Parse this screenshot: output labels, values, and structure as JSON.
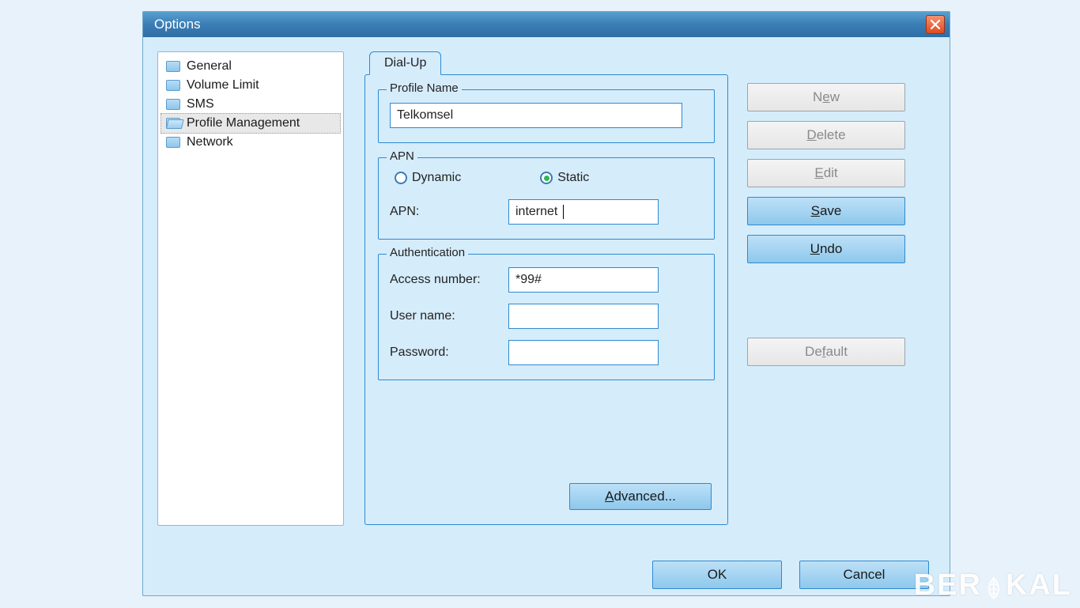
{
  "window": {
    "title": "Options"
  },
  "nav": {
    "items": [
      {
        "label": "General"
      },
      {
        "label": "Volume Limit"
      },
      {
        "label": "SMS"
      },
      {
        "label": "Profile Management",
        "selected": true
      },
      {
        "label": "Network"
      }
    ]
  },
  "tab": {
    "label": "Dial-Up"
  },
  "groups": {
    "profile": {
      "legend": "Profile Name",
      "value": "Telkomsel"
    },
    "apn": {
      "legend": "APN",
      "radio_dynamic": "Dynamic",
      "radio_static": "Static",
      "selected": "static",
      "apn_label": "APN:",
      "apn_value": "internet"
    },
    "auth": {
      "legend": "Authentication",
      "access_label": "Access number:",
      "access_value": "*99#",
      "user_label": "User name:",
      "user_value": "",
      "pass_label": "Password:",
      "pass_value": ""
    }
  },
  "buttons": {
    "new": {
      "pre": "N",
      "u": "e",
      "post": "w"
    },
    "delete": {
      "pre": "",
      "u": "D",
      "post": "elete"
    },
    "edit": {
      "pre": "",
      "u": "E",
      "post": "dit"
    },
    "save": {
      "pre": "",
      "u": "S",
      "post": "ave"
    },
    "undo": {
      "pre": "",
      "u": "U",
      "post": "ndo"
    },
    "default": {
      "pre": "De",
      "u": "f",
      "post": "ault"
    },
    "advanced": {
      "pre": "",
      "u": "A",
      "post": "dvanced..."
    },
    "ok": "OK",
    "cancel": "Cancel"
  },
  "watermark": {
    "pre": "BER",
    "post": "KAL"
  }
}
